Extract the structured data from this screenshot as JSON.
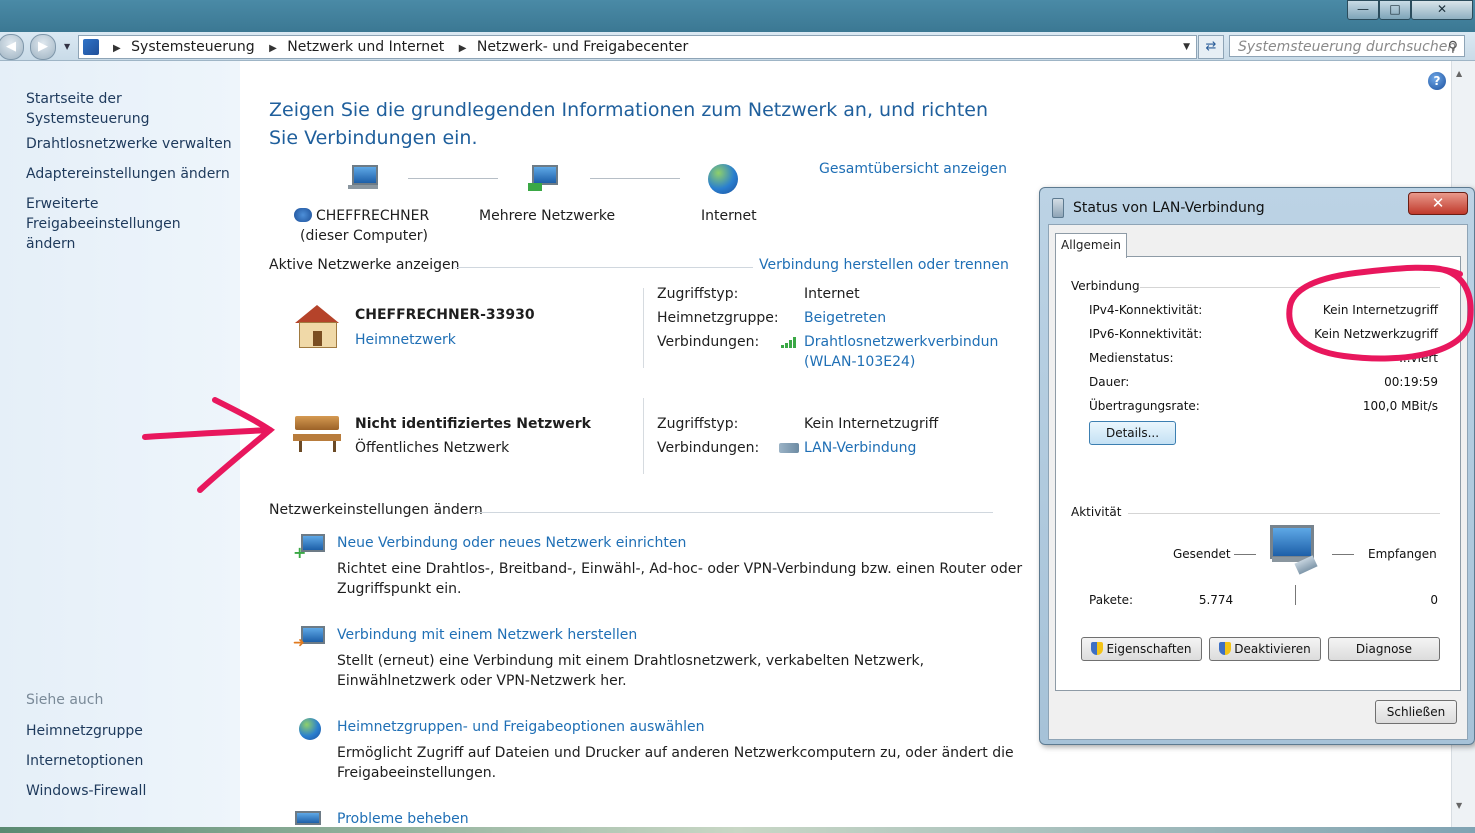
{
  "titlebar": {
    "minimize_icon": "minimize-icon",
    "maximize_icon": "maximize-icon",
    "close_icon": "close-icon"
  },
  "address": {
    "root_icon": "control-panel-icon",
    "crumbs": [
      "Systemsteuerung",
      "Netzwerk und Internet",
      "Netzwerk- und Freigabecenter"
    ],
    "search_placeholder": "Systemsteuerung durchsuchen"
  },
  "sidebar": {
    "items": [
      "Startseite der Systemsteuerung",
      "Drahtlosnetzwerke verwalten",
      "Adaptereinstellungen ändern",
      "Erweiterte Freigabeeinstellungen ändern"
    ],
    "see_also_title": "Siehe auch",
    "see_also": [
      "Heimnetzgruppe",
      "Internetoptionen",
      "Windows-Firewall"
    ]
  },
  "main": {
    "heading": "Zeigen Sie die grundlegenden Informationen zum Netzwerk an, und richten Sie Verbindungen ein.",
    "overview_link": "Gesamtübersicht anzeigen",
    "map": {
      "computer_name": "CHEFFRECHNER",
      "computer_sub": "(dieser Computer)",
      "middle": "Mehrere Netzwerke",
      "internet": "Internet"
    },
    "active_title": "Aktive Netzwerke anzeigen",
    "connect_link": "Verbindung herstellen oder trennen",
    "network1": {
      "name": "CHEFFRECHNER-33930",
      "type_link": "Heimnetzwerk",
      "access_label": "Zugriffstyp:",
      "access_value": "Internet",
      "homegroup_label": "Heimnetzgruppe:",
      "homegroup_value": "Beigetreten",
      "connections_label": "Verbindungen:",
      "connection_line1": "Drahtlosnetzwerkverbindun",
      "connection_line2": "(WLAN-103E24)"
    },
    "network2": {
      "name": "Nicht identifiziertes Netzwerk",
      "type": "Öffentliches Netzwerk",
      "access_label": "Zugriffstyp:",
      "access_value": "Kein Internetzugriff",
      "connections_label": "Verbindungen:",
      "connection": "LAN-Verbindung"
    },
    "settings_title": "Netzwerkeinstellungen ändern",
    "tasks": [
      {
        "title": "Neue Verbindung oder neues Netzwerk einrichten",
        "desc1": "Richtet eine Drahtlos-, Breitband-, Einwähl-, Ad-hoc- oder VPN-Verbindung bzw. einen Router oder",
        "desc2": "Zugriffspunkt ein."
      },
      {
        "title": "Verbindung mit einem Netzwerk herstellen",
        "desc1": "Stellt (erneut) eine Verbindung mit einem Drahtlosnetzwerk, verkabelten Netzwerk,",
        "desc2": "Einwählnetzwerk oder VPN-Netzwerk her."
      },
      {
        "title": "Heimnetzgruppen- und Freigabeoptionen auswählen",
        "desc1": "Ermöglicht Zugriff auf Dateien und Drucker auf anderen Netzwerkcomputern zu, oder ändert die",
        "desc2": "Freigabeeinstellungen."
      },
      {
        "title": "Probleme beheben"
      }
    ]
  },
  "dialog": {
    "title": "Status von LAN-Verbindung",
    "tab": "Allgemein",
    "connection_group": "Verbindung",
    "rows": [
      {
        "label": "IPv4-Konnektivität:",
        "value": "Kein Internetzugriff"
      },
      {
        "label": "IPv6-Konnektivität:",
        "value": "Kein Netzwerkzugriff"
      },
      {
        "label": "Medienstatus:",
        "value": "...viert"
      },
      {
        "label": "Dauer:",
        "value": "00:19:59"
      },
      {
        "label": "Übertragungsrate:",
        "value": "100,0 MBit/s"
      }
    ],
    "details_button": "Details...",
    "activity_group": "Aktivität",
    "sent_label": "Gesendet",
    "received_label": "Empfangen",
    "packets_label": "Pakete:",
    "packets_sent": "5.774",
    "packets_received": "0",
    "properties_button": "Eigenschaften",
    "disable_button": "Deaktivieren",
    "diagnose_button": "Diagnose",
    "close_button": "Schließen"
  },
  "annotations": {
    "circle_color": "#e8175d",
    "arrow_color": "#e8175d"
  }
}
